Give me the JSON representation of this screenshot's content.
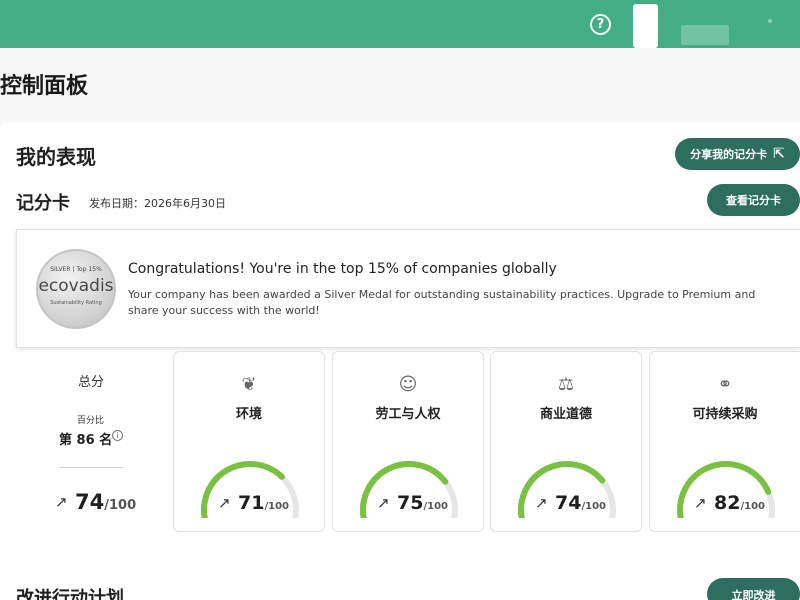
{
  "topbar": {
    "help_icon": "?",
    "brand_color": "#43ad85"
  },
  "page_title": "控制面板",
  "performance": {
    "title": "我的表现",
    "share_button": "分享我的记分卡",
    "share_icon": "share-icon"
  },
  "scorecard": {
    "title": "记分卡",
    "publish_date": "发布日期：2026年6月30日",
    "view_button": "查看记分卡"
  },
  "banner": {
    "medal": {
      "top": "SILVER | Top 15%",
      "logo": "ecovadis",
      "sub": "Sustainability Rating"
    },
    "title": "Congratulations! You're in the top 15% of companies globally",
    "body": "Your company has been awarded a Silver Medal for outstanding sustainability practices. Upgrade to Premium and share your success with the world!"
  },
  "overall": {
    "title": "总分",
    "percentile_label": "百分比",
    "rank": "第 86 名",
    "arrow": "↗",
    "score": "74",
    "max": "/100"
  },
  "categories": [
    {
      "title": "环境",
      "icon": "leaf-icon",
      "glyph": "❦",
      "arrow": "↗",
      "score": "71",
      "max": "/100",
      "value": 71
    },
    {
      "title": "劳工与人权",
      "icon": "people-icon",
      "glyph": "☺",
      "arrow": "↗",
      "score": "75",
      "max": "/100",
      "value": 75
    },
    {
      "title": "商业道德",
      "icon": "scales-icon",
      "glyph": "⚖",
      "arrow": "↗",
      "score": "74",
      "max": "/100",
      "value": 74
    },
    {
      "title": "可持续采购",
      "icon": "link-icon",
      "glyph": "⚭",
      "arrow": "↗",
      "score": "82",
      "max": "/100",
      "value": 82
    }
  ],
  "gauge_colors": {
    "fill": "#7ac143",
    "track": "#e6e6e6"
  },
  "action_plan": {
    "title": "改进行动计划",
    "improve_button": "立即改进"
  }
}
